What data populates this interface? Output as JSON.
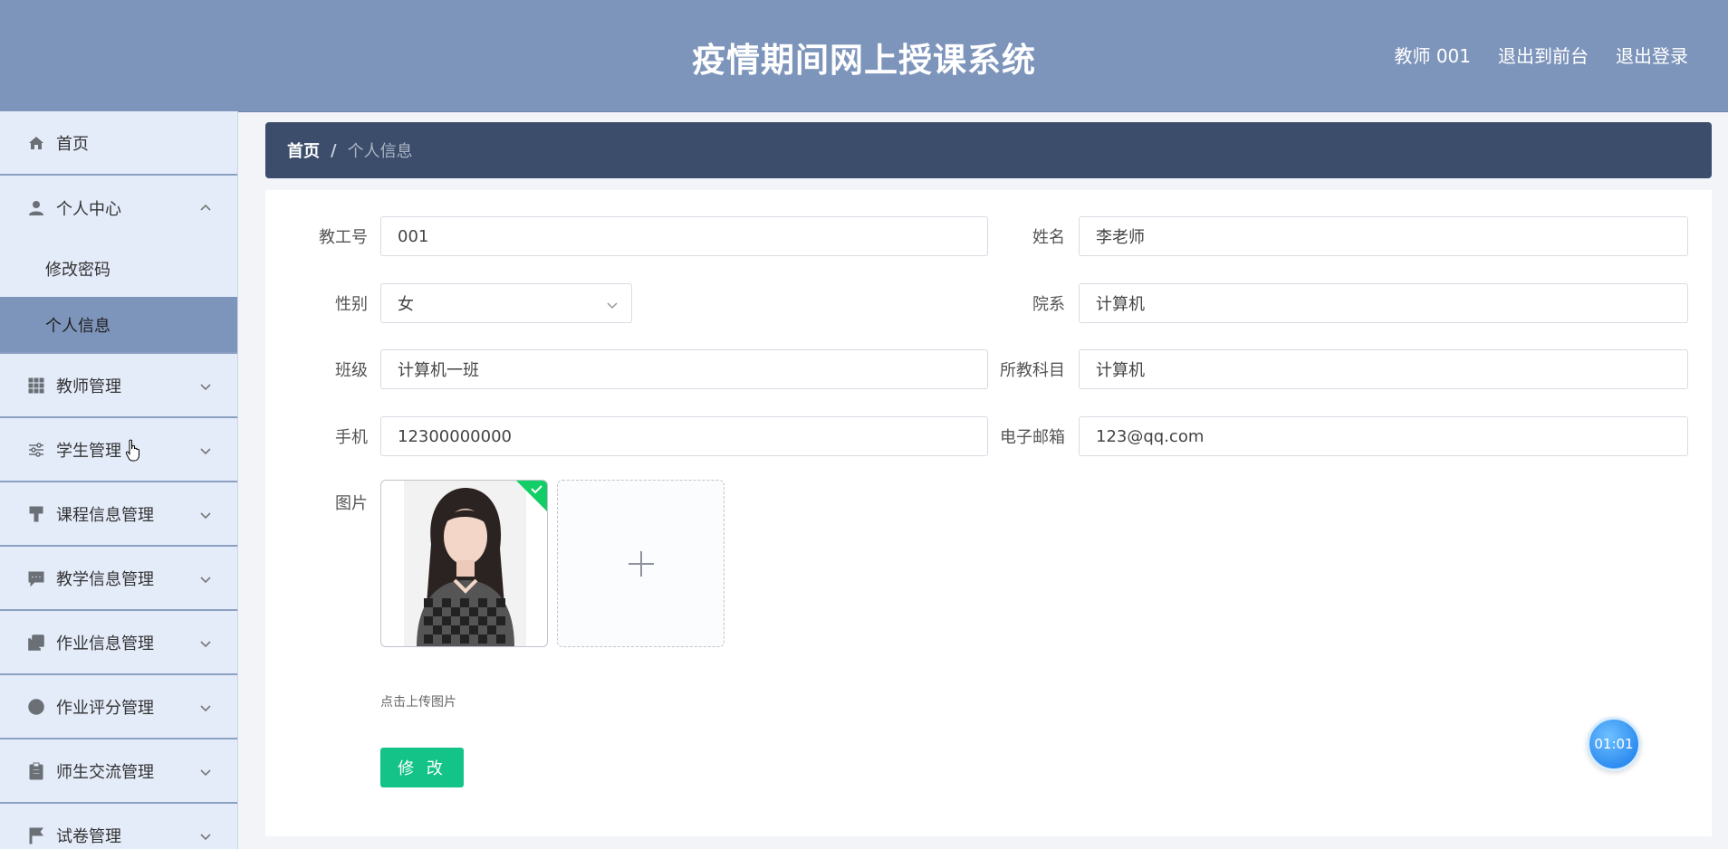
{
  "header": {
    "title": "疫情期间网上授课系统",
    "nav": [
      "教师 001",
      "退出到前台",
      "退出登录"
    ]
  },
  "sidebar": {
    "home": "首页",
    "personal_center": "个人中心",
    "sub_items": [
      "修改密码",
      "个人信息"
    ],
    "items": [
      "教师管理",
      "学生管理",
      "课程信息管理",
      "教学信息管理",
      "作业信息管理",
      "作业评分管理",
      "师生交流管理",
      "试卷管理"
    ]
  },
  "breadcrumb": {
    "home": "首页",
    "separator": "/",
    "current": "个人信息"
  },
  "form": {
    "teacher_id_label": "教工号",
    "teacher_id": "001",
    "name_label": "姓名",
    "name": "李老师",
    "gender_label": "性别",
    "gender": "女",
    "department_label": "院系",
    "department": "计算机",
    "class_label": "班级",
    "class": "计算机一班",
    "subject_label": "所教科目",
    "subject": "计算机",
    "phone_label": "手机",
    "phone": "12300000000",
    "email_label": "电子邮箱",
    "email": "123@qq.com",
    "picture_label": "图片",
    "upload_hint": "点击上传图片",
    "submit_label": "修 改"
  },
  "timer": "01:01",
  "colors": {
    "header": "#7e95bb",
    "breadcrumb": "#3c4d6b",
    "sidebar": "#e4ecfa",
    "submit": "#13c387"
  }
}
